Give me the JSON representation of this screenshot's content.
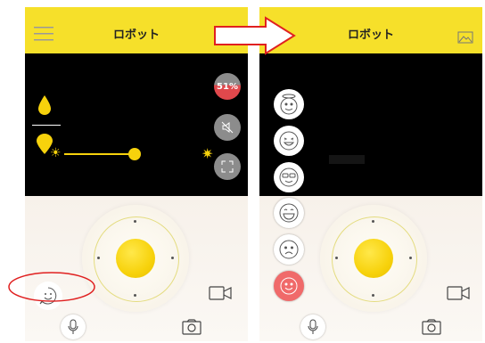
{
  "left_screen": {
    "title": "ロボット",
    "menu_icon": "hamburger-icon",
    "battery_percent": "51%",
    "brightness_level": 0.65,
    "buttons": [
      "mute-icon",
      "fullscreen-icon",
      "emoji-icon",
      "microphone-icon",
      "camera-icon",
      "video-camera-icon"
    ]
  },
  "right_screen": {
    "title": "ロボット",
    "gallery_icon": "image-icon",
    "expressions": [
      "angel-face",
      "laughing-face",
      "sunglasses-face",
      "grinning-face",
      "sad-face",
      "smiley-face"
    ]
  },
  "colors": {
    "header": "#f6e02a",
    "accent_yellow": "#f7d20c",
    "battery_red": "#e0484c",
    "highlight_ring": "#e02020",
    "selected_expression": "#f06a6a"
  }
}
